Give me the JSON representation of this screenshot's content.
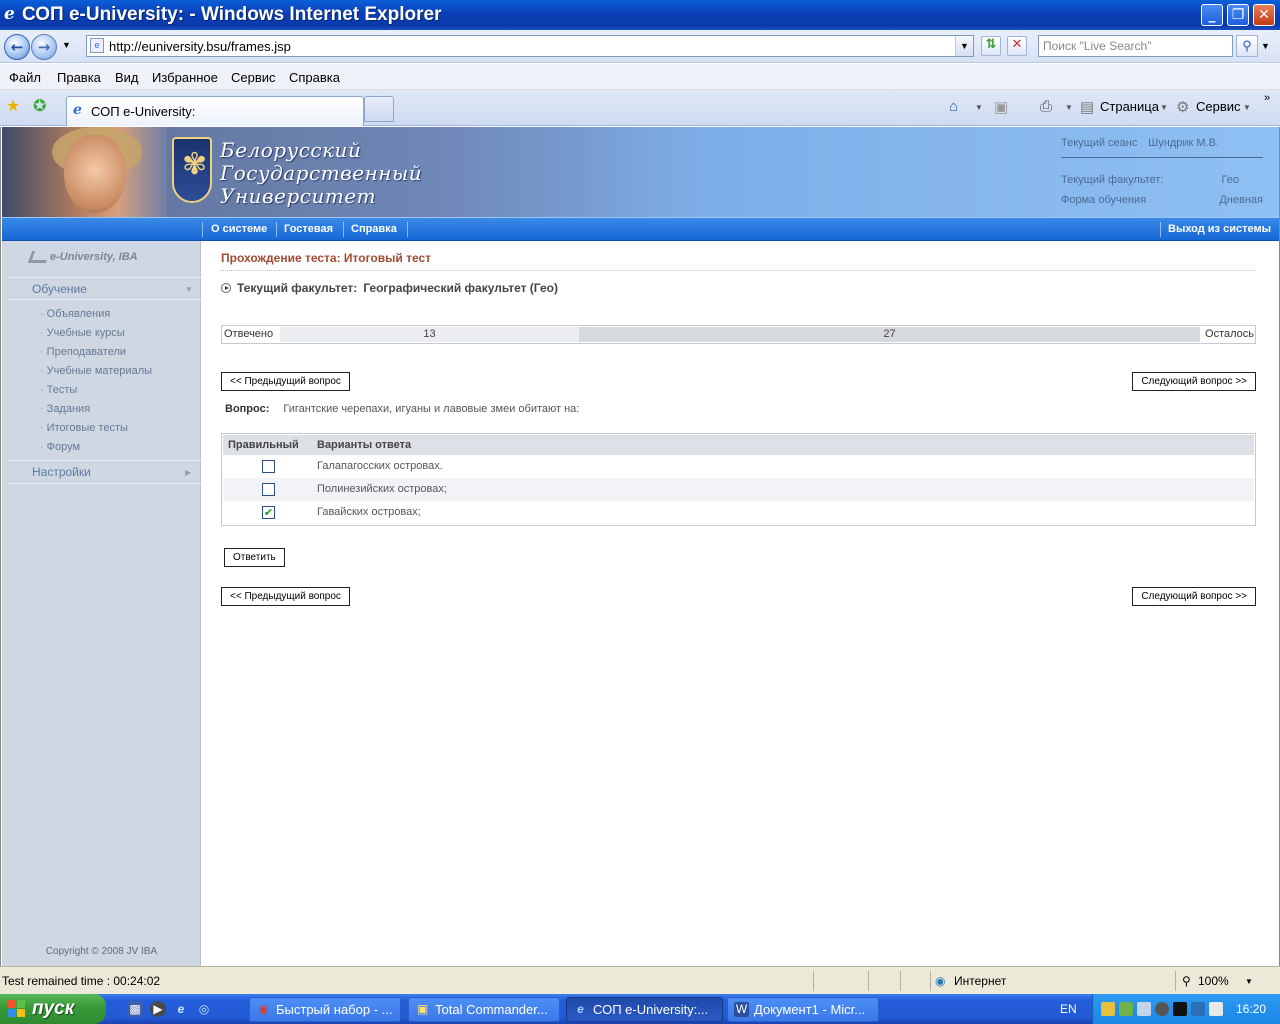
{
  "window": {
    "title": "СОП e-University:  - Windows Internet Explorer",
    "minimize_glyph": "_",
    "maximize_glyph": "❐",
    "close_glyph": "✕"
  },
  "address_bar": {
    "url": "http://euniversity.bsu/frames.jsp",
    "search_placeholder": "Поиск \"Live Search\""
  },
  "menu": [
    "Файл",
    "Правка",
    "Вид",
    "Избранное",
    "Сервис",
    "Справка"
  ],
  "tabs": {
    "active_label": "СОП e-University:"
  },
  "toolbar": {
    "page_label": "Страница",
    "tools_label": "Сервис"
  },
  "banner": {
    "university_lines": [
      "Белорусский",
      "Государственный",
      "Университет"
    ],
    "session_label": "Текущий сеанс",
    "session_user": "Шундрик М.В.",
    "faculty_label": "Текущий факультет:",
    "faculty_value": "Гео",
    "study_form_label": "Форма обучения",
    "study_form_value": "Дневная"
  },
  "nav": {
    "items": [
      "О системе",
      "Гостевая",
      "Справка"
    ],
    "logout": "Выход из системы"
  },
  "sidebar": {
    "logo_text": "e-University, IBA",
    "section_learning": "Обучение",
    "items": [
      "Объявления",
      "Учебные курсы",
      "Преподаватели",
      "Учебные материалы",
      "Тесты",
      "Задания",
      "Итоговые тесты",
      "Форум"
    ],
    "section_settings": "Настройки",
    "copyright": "Copyright © 2008 JV IBA"
  },
  "main": {
    "title": "Прохождение теста: Итоговый тест",
    "faculty_label": "Текущий факультет:",
    "faculty_value": "Географический факультет (Гео)",
    "progress": {
      "answered_label": "Отвечено",
      "answered": 13,
      "remaining": 27,
      "remaining_label": "Осталось",
      "answered_fraction": 0.325
    },
    "prev_button": "<< Предыдущий вопрос",
    "next_button": "Следующий вопрос >>",
    "question_label": "Вопрос:",
    "question_text": "Гигантские черепахи, игуаны и лавовые змеи обитают на:",
    "table": {
      "col_correct": "Правильный",
      "col_options": "Варианты ответа",
      "options": [
        {
          "text": "Галапагосских островах.",
          "checked": false
        },
        {
          "text": "Полинезийских островах;",
          "checked": false
        },
        {
          "text": "Гавайских островах;",
          "checked": true
        }
      ]
    },
    "answer_button": "Ответить"
  },
  "status_bar": {
    "timer_text": "Test remained time :  00:24:02",
    "zone": "Интернет",
    "zoom": "100%"
  },
  "taskbar": {
    "start": "пуск",
    "tasks": [
      "Быстрый набор - ...",
      "Total Commander...",
      "СОП e-University:...",
      "Документ1 - Micr..."
    ],
    "lang": "EN",
    "clock": "16:20"
  },
  "colors": {
    "title_accent": "#a04b32",
    "nav_blue": "#1666d6",
    "sidebar_bg": "#cfd7e3"
  }
}
